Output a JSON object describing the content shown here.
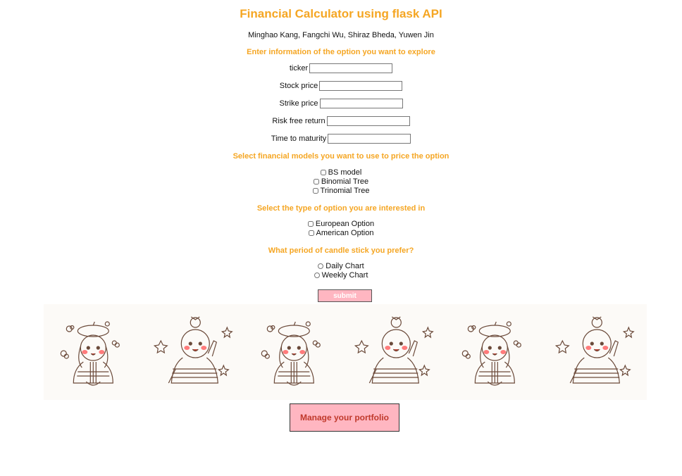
{
  "header": {
    "title": "Financial Calculator using flask API",
    "authors": "Minghao Kang, Fangchi Wu, Shiraz Bheda, Yuwen Jin"
  },
  "option_info": {
    "heading": "Enter information of the option you want to explore",
    "fields": [
      {
        "label": "ticker",
        "value": ""
      },
      {
        "label": "Stock price",
        "value": ""
      },
      {
        "label": "Strike price",
        "value": ""
      },
      {
        "label": "Risk free return",
        "value": ""
      },
      {
        "label": "Time to maturity",
        "value": ""
      }
    ]
  },
  "models": {
    "heading": "Select financial models you want to use to price the option",
    "options": [
      "BS model",
      "Binomial Tree",
      "Trinomial Tree"
    ]
  },
  "option_type": {
    "heading": "Select the type of option you are interested in",
    "options": [
      "European Option",
      "American Option"
    ]
  },
  "candle_period": {
    "heading": "What period of candle stick you prefer?",
    "options": [
      "Daily Chart",
      "Weekly Chart"
    ]
  },
  "submit_label": "submit",
  "portfolio_label": "Manage your portfolio",
  "colors": {
    "accent": "#f5a623",
    "button_pink": "#ffb6c1",
    "portfolio_text": "#c0392b"
  },
  "icons": [
    "girl-with-beret-illustration",
    "girl-waving-illustration"
  ]
}
